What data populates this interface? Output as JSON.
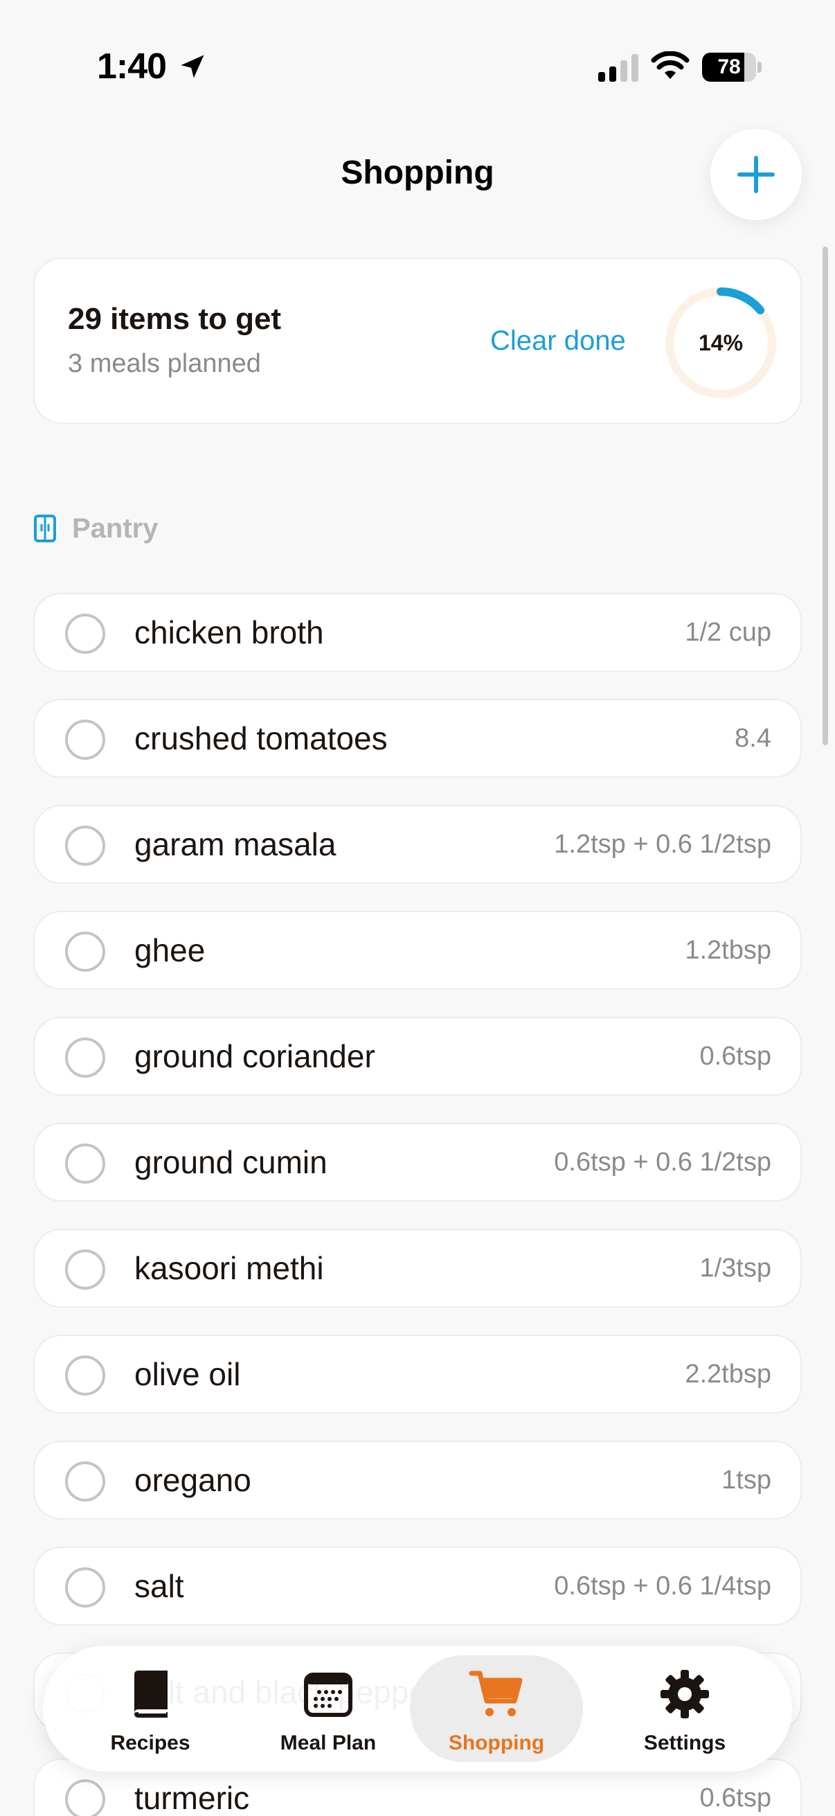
{
  "status_bar": {
    "time": "1:40",
    "battery_level": "78",
    "battery_fraction": 0.78
  },
  "header": {
    "title": "Shopping",
    "add_icon": "plus-icon"
  },
  "summary": {
    "items_to_get": "29 items to get",
    "meals_planned": "3 meals planned",
    "clear_done_label": "Clear done",
    "progress_label": "14%",
    "progress_fraction": 0.14
  },
  "section": {
    "label": "Pantry",
    "icon": "pantry-icon"
  },
  "items": [
    {
      "name": "chicken broth",
      "quantity": "1/2 cup",
      "checked": false
    },
    {
      "name": "crushed tomatoes",
      "quantity": "8.4",
      "checked": false
    },
    {
      "name": "garam masala",
      "quantity": "1.2tsp + 0.6 1/2tsp",
      "checked": false
    },
    {
      "name": "ghee",
      "quantity": "1.2tbsp",
      "checked": false
    },
    {
      "name": "ground coriander",
      "quantity": "0.6tsp",
      "checked": false
    },
    {
      "name": "ground cumin",
      "quantity": "0.6tsp + 0.6 1/2tsp",
      "checked": false
    },
    {
      "name": "kasoori methi",
      "quantity": "1/3tsp",
      "checked": false
    },
    {
      "name": "olive oil",
      "quantity": "2.2tbsp",
      "checked": false
    },
    {
      "name": "oregano",
      "quantity": "1tsp",
      "checked": false
    },
    {
      "name": "salt",
      "quantity": "0.6tsp + 0.6 1/4tsp",
      "checked": false
    },
    {
      "name": "salt and black pepper",
      "quantity": "",
      "checked": false
    },
    {
      "name": "turmeric",
      "quantity": "0.6tsp",
      "checked": false
    }
  ],
  "tab_bar": {
    "tabs": [
      {
        "label": "Recipes",
        "icon": "book-icon",
        "active": false
      },
      {
        "label": "Meal Plan",
        "icon": "calendar-icon",
        "active": false
      },
      {
        "label": "Shopping",
        "icon": "cart-icon",
        "active": true
      },
      {
        "label": "Settings",
        "icon": "gear-icon",
        "active": false
      }
    ]
  },
  "colors": {
    "accent_blue": "#1a9fd6",
    "accent_orange": "#e8751f",
    "ring_track": "#fdf1e6"
  }
}
